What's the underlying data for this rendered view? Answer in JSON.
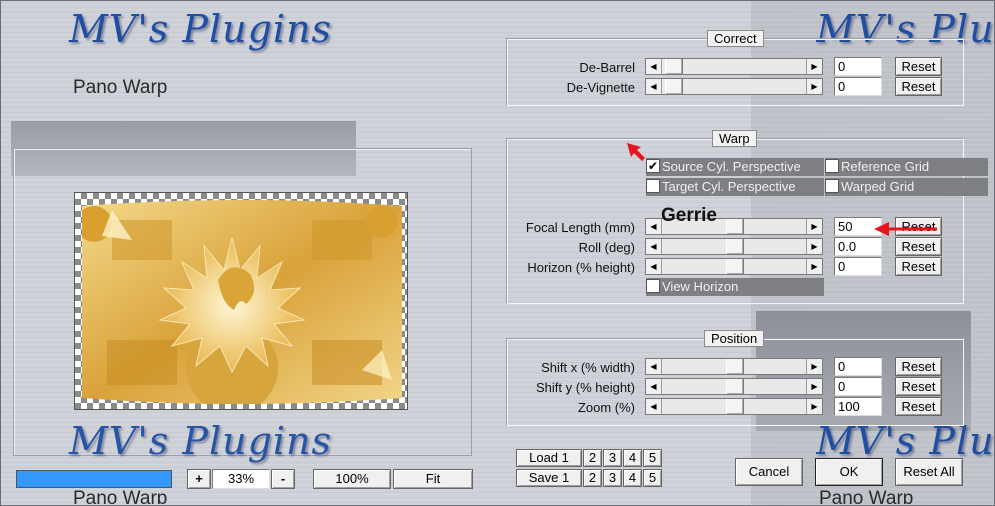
{
  "branding": {
    "logo_text": "MV's Plugins",
    "plugin_name": "Pano Warp",
    "watermark": "Gerrie"
  },
  "preview": {
    "zoom_level": "33%",
    "zoom_plus": "+",
    "zoom_minus": "-",
    "zoom_100_label": "100%",
    "fit_label": "Fit"
  },
  "presets": {
    "load_label": "Load 1",
    "save_label": "Save 1",
    "slots": [
      "2",
      "3",
      "4",
      "5"
    ]
  },
  "correct": {
    "title": "Correct",
    "rows": [
      {
        "label": "De-Barrel",
        "value": "0",
        "reset": "Reset"
      },
      {
        "label": "De-Vignette",
        "value": "0",
        "reset": "Reset"
      }
    ]
  },
  "warp": {
    "title": "Warp",
    "checkboxes": {
      "source_cyl": {
        "label": "Source Cyl. Perspective",
        "checked": true
      },
      "reference_grid": {
        "label": "Reference Grid",
        "checked": false
      },
      "target_cyl": {
        "label": "Target Cyl. Perspective",
        "checked": false
      },
      "warped_grid": {
        "label": "Warped Grid",
        "checked": false
      },
      "view_horizon": {
        "label": "View Horizon",
        "checked": false
      }
    },
    "rows": [
      {
        "label": "Focal Length (mm)",
        "value": "50",
        "reset": "Reset"
      },
      {
        "label": "Roll (deg)",
        "value": "0.0",
        "reset": "Reset"
      },
      {
        "label": "Horizon (% height)",
        "value": "0",
        "reset": "Reset"
      }
    ]
  },
  "position": {
    "title": "Position",
    "rows": [
      {
        "label": "Shift x (% width)",
        "value": "0",
        "reset": "Reset"
      },
      {
        "label": "Shift y (% height)",
        "value": "0",
        "reset": "Reset"
      },
      {
        "label": "Zoom (%)",
        "value": "100",
        "reset": "Reset"
      }
    ]
  },
  "footer": {
    "cancel_label": "Cancel",
    "ok_label": "OK",
    "reset_all_label": "Reset All"
  },
  "colors": {
    "logo_blue": "#1f4fa3",
    "accent_red": "#e8141c",
    "progress_blue": "#3399ff",
    "checkbox_strip": "#7d7f83"
  }
}
